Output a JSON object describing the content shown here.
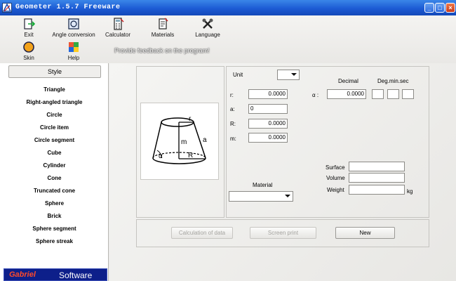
{
  "window": {
    "title": "Geometer 1.5.7 Freeware"
  },
  "toolbar": {
    "exit": "Exit",
    "angle_conversion": "Angle conversion",
    "calculator": "Calculator",
    "materials": "Materials",
    "language": "Language",
    "skin": "Skin",
    "help": "Help",
    "feedback": "Provide feedback on the program!"
  },
  "sidebar": {
    "style_label": "Style",
    "items": [
      {
        "label": "Triangle"
      },
      {
        "label": "Right-angled triangle"
      },
      {
        "label": "Circle"
      },
      {
        "label": "Circle item"
      },
      {
        "label": "Circle segment"
      },
      {
        "label": "Cube"
      },
      {
        "label": "Cylinder"
      },
      {
        "label": "Cone"
      },
      {
        "label": "Truncated cone"
      },
      {
        "label": "Sphere"
      },
      {
        "label": "Brick"
      },
      {
        "label": "Sphere segment"
      },
      {
        "label": "Sphere streak"
      }
    ],
    "brand_left": "Gabriel",
    "brand_right": "Software"
  },
  "diagram": {
    "labels": [
      "r",
      "a",
      "m",
      "α",
      "R"
    ]
  },
  "form": {
    "unit_label": "Unit",
    "r_label": "r:",
    "r_value": "0.0000",
    "a_label": "a:",
    "a_value": "0",
    "R_label": "R:",
    "R_value": "0.0000",
    "m_label": "m:",
    "m_value": "0.0000",
    "alpha_label": "α :",
    "decimal_label": "Decimal",
    "decimal_value": "0.0000",
    "degminsec_label": "Deg.min.sec",
    "material_label": "Material",
    "surface_label": "Surface",
    "volume_label": "Volume",
    "weight_label": "Weight",
    "weight_unit": "kg"
  },
  "buttons": {
    "calculation": "Calculation of data",
    "screen_print": "Screen print",
    "new": "New"
  },
  "colors": {
    "titlebar": "#1c5bd4",
    "brand_bg": "#0d1f8a",
    "brand_accent": "#ff4a2a"
  }
}
